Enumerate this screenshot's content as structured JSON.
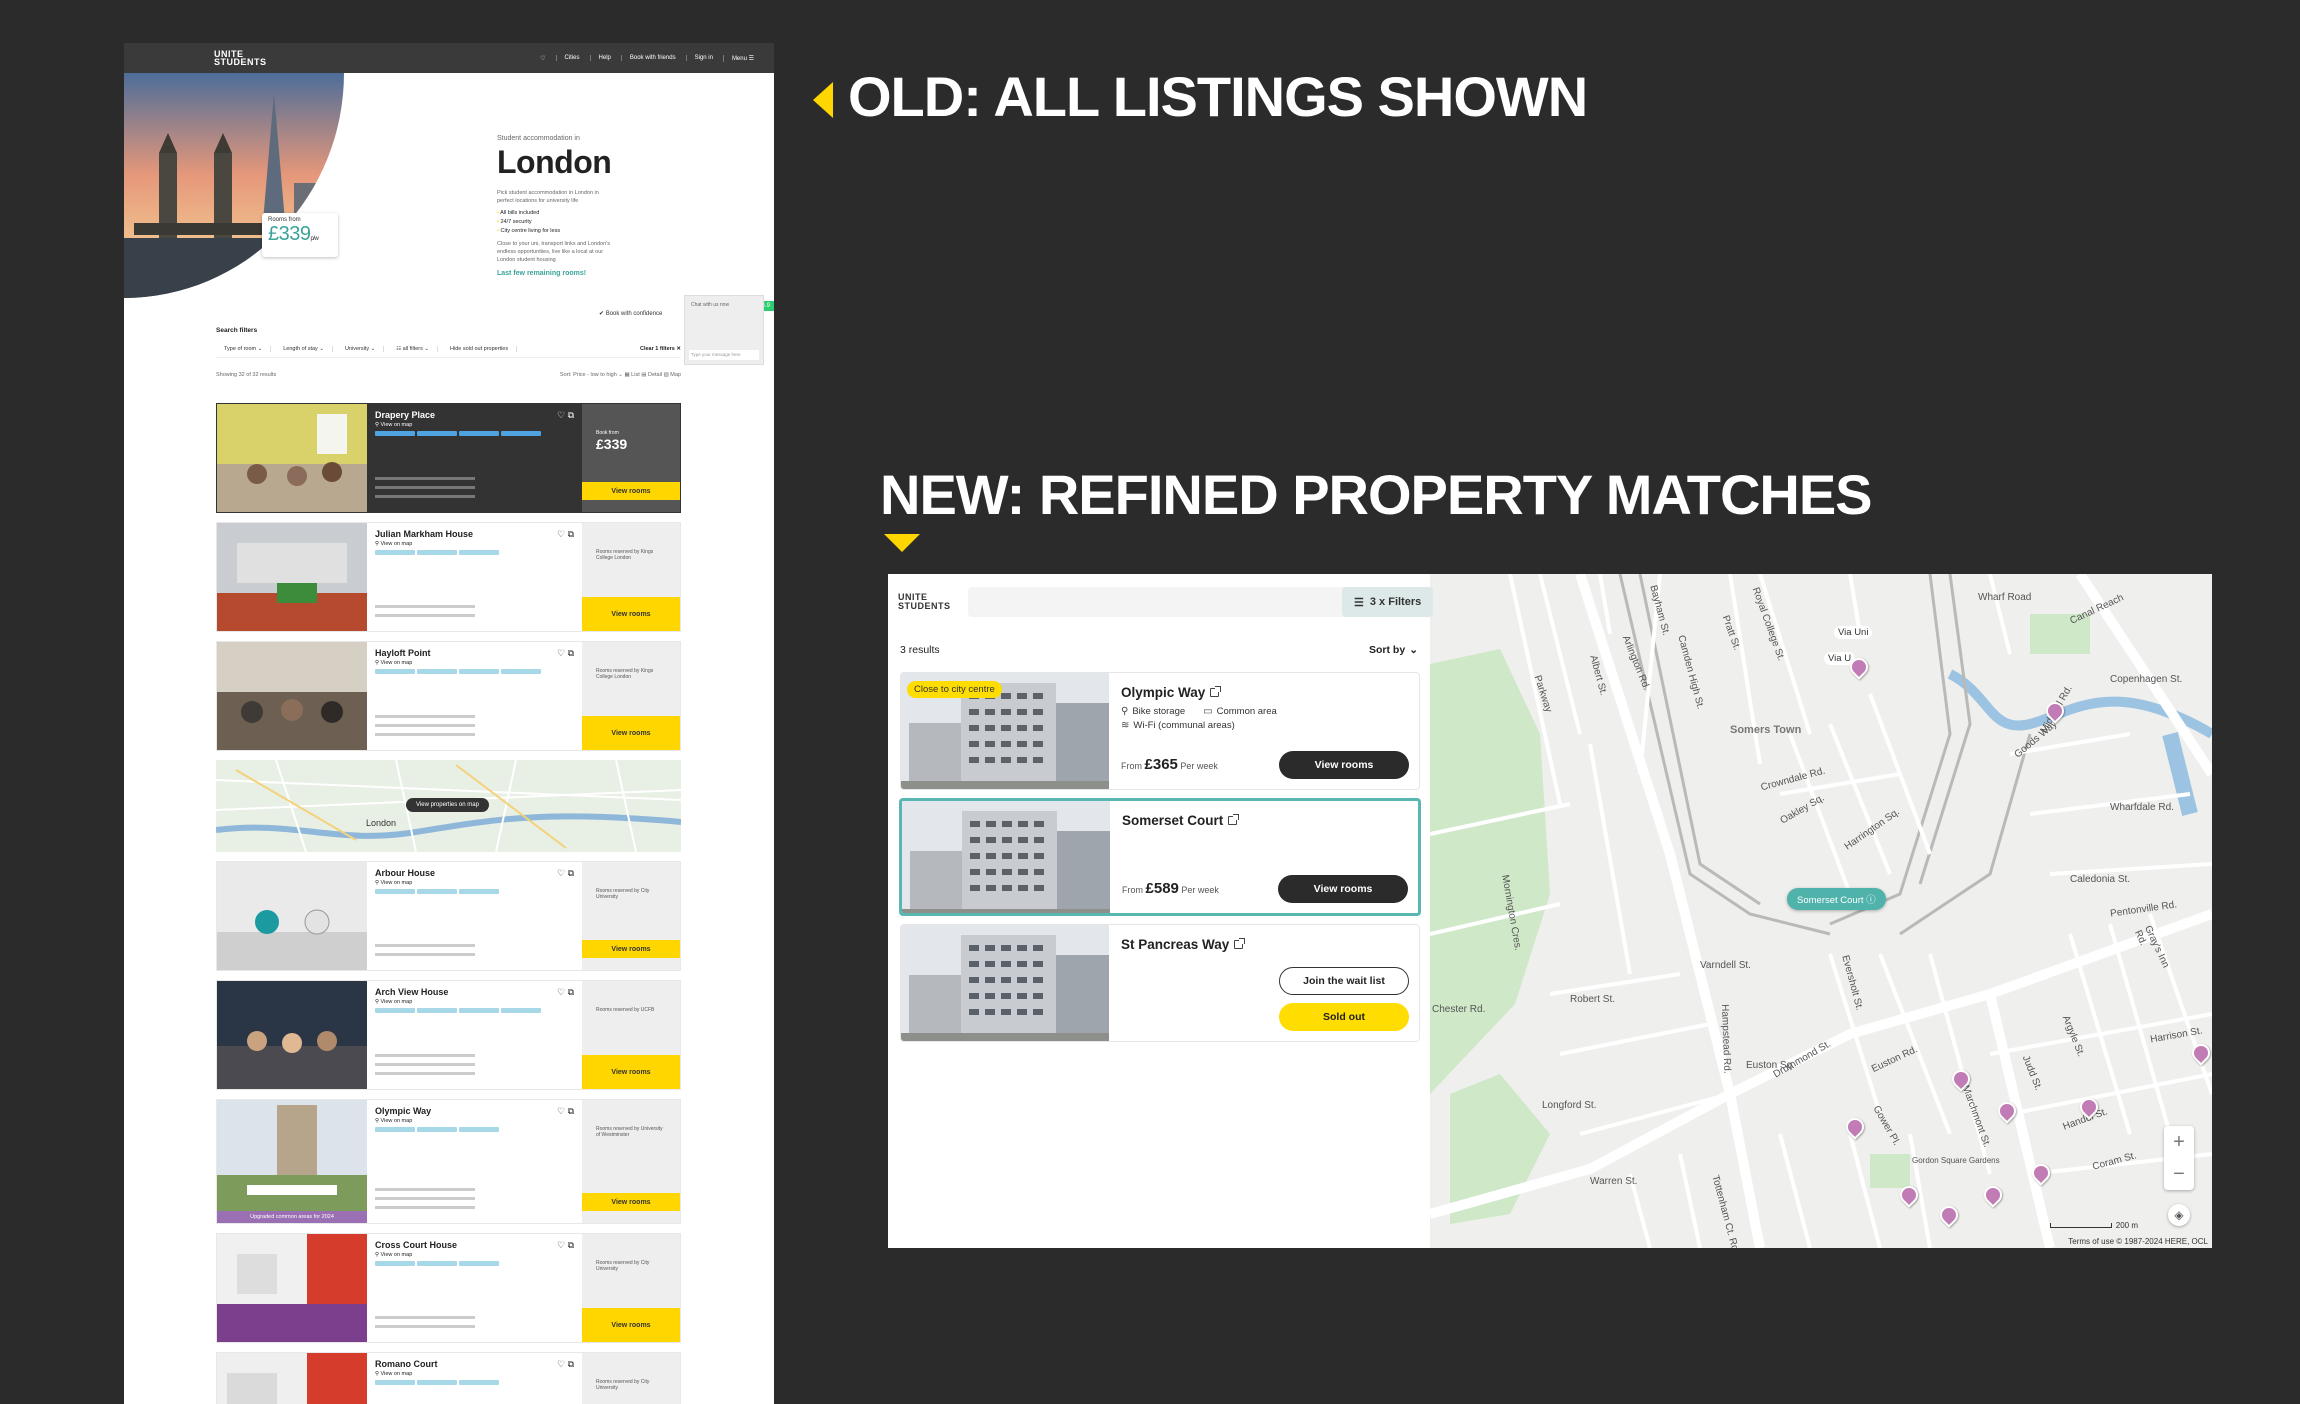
{
  "headlines": {
    "old": "OLD: ALL LISTINGS SHOWN",
    "new": "NEW: REFINED PROPERTY MATCHES"
  },
  "accent_color": "#ffd600",
  "teal_color": "#3aa39a",
  "old_site": {
    "logo_line1": "UNITE",
    "logo_line2": "STUDENTS",
    "nav": [
      "♡",
      "Cities",
      "Help",
      "Book with friends",
      "Sign in",
      "Menu ☰"
    ],
    "hero": {
      "kicker": "Student accommodation in",
      "city": "London",
      "intro": "Pick student accommodation in London in perfect locations for university life",
      "bullets": [
        "All bills included",
        "24/7 security",
        "City centre living for less"
      ],
      "body": "Close to your uni, transport links and London's endless opportunities, live like a local at our London student housing",
      "remaining": "Last few remaining rooms!",
      "rooms_from_label": "Rooms from",
      "rooms_from_price": "£339",
      "rooms_from_unit": "p/w"
    },
    "green_tab": "+ 4.9",
    "confidence": "✔ Book with confidence",
    "chat": {
      "title": "Chat with us now",
      "placeholder": "Type your message here"
    },
    "filters": {
      "title": "Search filters",
      "items": [
        "Type of room ⌄",
        "Length of stay ⌄",
        "University ⌄",
        "☷ all filters ⌄",
        "Hide sold out properties"
      ],
      "clear": "Clear 1 filters ✕"
    },
    "results_count": "Showing 32 of 32 results",
    "sort": "Sort: Price - low to high ⌄   ▦ List  ▤ Detail  ▧ Map",
    "map_button": "View properties on map",
    "map_label": "London",
    "listings": [
      {
        "name": "Drapery Place",
        "map_link": "⚲ View on map",
        "side_note": "Book from",
        "side_price": "£339",
        "button": "View rooms",
        "dark": true
      },
      {
        "name": "Julian Markham House",
        "map_link": "⚲ View on map",
        "side_note": "Rooms reserved by Kings College London",
        "button": "View rooms"
      },
      {
        "name": "Hayloft Point",
        "map_link": "⚲ View on map",
        "side_note": "Rooms reserved by Kings College London",
        "button": "View rooms"
      },
      {
        "name": "Arbour House",
        "map_link": "⚲ View on map",
        "side_note": "Rooms reserved by City University",
        "button": "View rooms"
      },
      {
        "name": "Arch View House",
        "map_link": "⚲ View on map",
        "side_note": "Rooms reserved by UCFB",
        "button": "View rooms"
      },
      {
        "name": "Olympic Way",
        "map_link": "⚲ View on map",
        "side_note": "Rooms reserved by University of Westminster",
        "button": "View rooms",
        "banner": "Upgraded common areas for 2024"
      },
      {
        "name": "Cross Court House",
        "map_link": "⚲ View on map",
        "side_note": "Rooms reserved by City University",
        "button": "View rooms"
      },
      {
        "name": "Romano Court",
        "map_link": "⚲ View on map",
        "side_note": "Rooms reserved by City University",
        "button": "View rooms"
      }
    ]
  },
  "new_site": {
    "logo_line1": "UNITE",
    "logo_line2": "STUDENTS",
    "search_placeholder": "",
    "filters_button": "3 x Filters",
    "results": "3 results",
    "sort_by": "Sort by",
    "cards": [
      {
        "name": "Olympic Way",
        "badge": "Close to city centre",
        "amenities": [
          "Bike storage",
          "Common area",
          "Wi-Fi (communal areas)"
        ],
        "price_prefix": "From",
        "price": "£365",
        "price_suffix": "Per week",
        "button": "View rooms"
      },
      {
        "name": "Somerset Court",
        "price_prefix": "From",
        "price": "£589",
        "price_suffix": "Per week",
        "button": "View rooms"
      },
      {
        "name": "St Pancreas Way",
        "waitlist_button": "Join the wait list",
        "soldout_button": "Sold out"
      }
    ],
    "map": {
      "selected_pin": "Somerset Court ⓘ",
      "via_labels": [
        "Via Uni",
        "Via U"
      ],
      "scale": "200 m",
      "attribution": "Terms of use   © 1987-2024 HERE, OCL",
      "zoom_in": "+",
      "zoom_out": "−",
      "street_labels": [
        "Bayham St.",
        "Camden High St.",
        "Royal College St.",
        "Pratt St.",
        "Albert St.",
        "Parkway",
        "Arlington Rd.",
        "Crowndale Rd.",
        "Eversholt St.",
        "Hampstead Rd.",
        "Euston Rd.",
        "Pentonville Rd.",
        "Gray's Inn Rd.",
        "Caledonia St.",
        "Wharfdale Rd.",
        "Copenhagen St.",
        "Chester Rd.",
        "Robert St.",
        "Longford St.",
        "Warren St.",
        "Gower Pl.",
        "Euston Sq.",
        "Gordon Square Gardens",
        "Handel St.",
        "Coram St.",
        "Harrison St.",
        "Marchmont St.",
        "Judd St.",
        "Argyle St.",
        "Somers Town",
        "Midland Rd.",
        "Goods Way",
        "Canal Reach",
        "Wharf Road",
        "Varndell St.",
        "Mornington Cres.",
        "Oakley Sq.",
        "Harrington Sq.",
        "Drummond St.",
        "Tottenham Ct. Rd."
      ]
    }
  }
}
